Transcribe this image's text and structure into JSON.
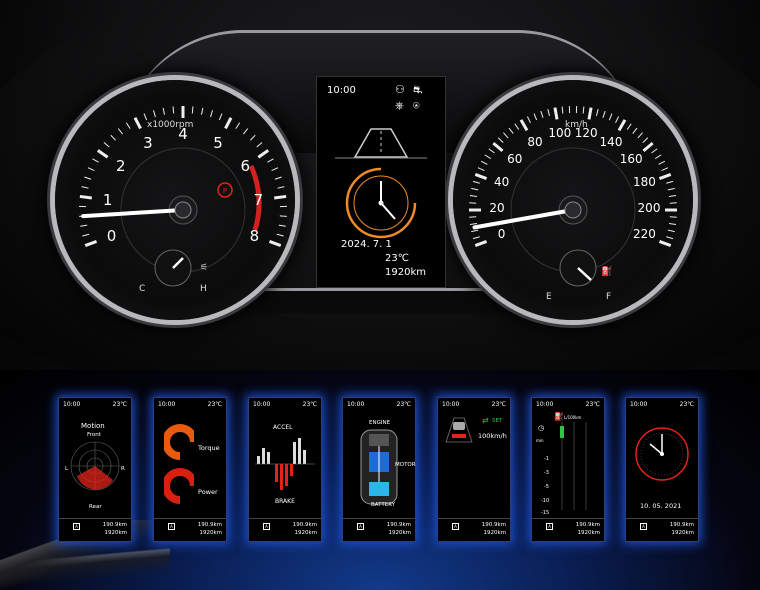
{
  "tachometer": {
    "unit_label": "x1000rpm",
    "scale": [
      "0",
      "1",
      "2",
      "3",
      "4",
      "5",
      "6",
      "7",
      "8"
    ],
    "needle_value": 0.6,
    "temp_low": "C",
    "temp_high": "H"
  },
  "speedometer": {
    "unit_label": "km/h",
    "scale": [
      "0",
      "20",
      "40",
      "60",
      "80",
      "100",
      "120",
      "140",
      "160",
      "180",
      "200",
      "220"
    ],
    "needle_value": 10,
    "fuel_empty": "E",
    "fuel_full": "F"
  },
  "center_display": {
    "time": "10:00",
    "date": "2024. 7. 1",
    "temperature": "23℃",
    "odometer": "1920km"
  },
  "screens": [
    {
      "time": "10:00",
      "temp": "23℃",
      "title": "Motion",
      "sub1": "Front",
      "sub2": "Rear",
      "lbl_l": "L",
      "lbl_r": "R",
      "trip": "190.9km",
      "odo": "1920km"
    },
    {
      "time": "10:00",
      "temp": "23℃",
      "label1": "Torque",
      "label2": "Power",
      "trip": "190.9km",
      "odo": "1920km"
    },
    {
      "time": "10:00",
      "temp": "23℃",
      "label1": "ACCEL",
      "label2": "BRAKE",
      "trip": "190.9km",
      "odo": "1920km"
    },
    {
      "time": "10:00",
      "temp": "23℃",
      "label1": "ENGINE",
      "label2": "MOTOR",
      "label3": "BATTERY",
      "trip": "190.9km",
      "odo": "1920km"
    },
    {
      "time": "10:00",
      "temp": "23℃",
      "label1": "SET",
      "label2": "100km/h",
      "trip": "190.9km",
      "odo": "1920km"
    },
    {
      "time": "10:00",
      "temp": "23℃",
      "label1": "L/100km",
      "ticks": [
        "-1",
        "-3",
        "-5",
        "-10",
        "-15"
      ],
      "trip": "190.9km",
      "odo": "1920km"
    },
    {
      "time": "10:00",
      "temp": "23℃",
      "date": "10. 05. 2021",
      "trip": "190.9km",
      "odo": "1920km"
    }
  ],
  "colors": {
    "accent_blue": "#1d4fd1",
    "warning_red": "#e2231a",
    "clock_orange": "#f08a24",
    "set_green": "#27c93f"
  }
}
